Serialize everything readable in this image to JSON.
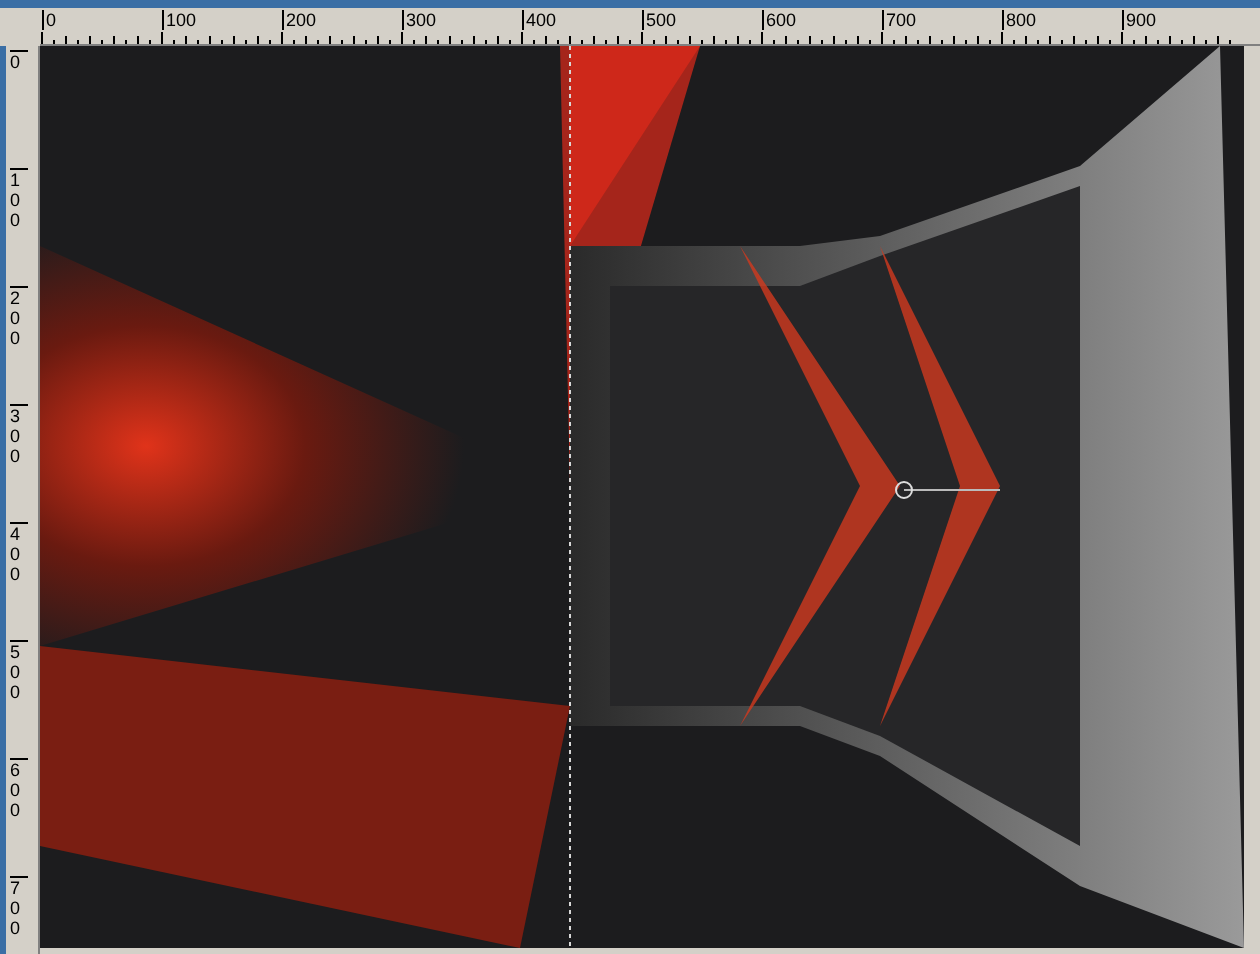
{
  "top_ruler": {
    "labels": [
      "0",
      "100",
      "200",
      "300",
      "400",
      "500",
      "600",
      "700",
      "800",
      "900"
    ]
  },
  "left_ruler": {
    "labels": [
      "0",
      "100",
      "200",
      "300",
      "400",
      "500",
      "600",
      "700"
    ]
  }
}
